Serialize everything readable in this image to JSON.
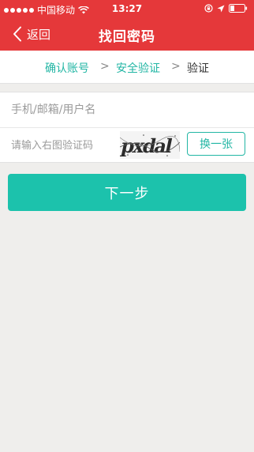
{
  "status_bar": {
    "carrier": "中国移动",
    "time": "13:27"
  },
  "nav": {
    "back_label": "返回",
    "title": "找回密码"
  },
  "steps": {
    "items": [
      "确认账号",
      "安全验证",
      "验证"
    ],
    "separator": ">",
    "active_color": "#22b6a4",
    "current_color": "#333333"
  },
  "form": {
    "account_placeholder": "手机/邮箱/用户名",
    "account_value": "",
    "captcha_placeholder": "请输入右图验证码",
    "captcha_value": "",
    "captcha_image_text": "pxdal",
    "refresh_label": "换一张"
  },
  "actions": {
    "next_label": "下一步"
  },
  "colors": {
    "header": "#e5383a",
    "accent": "#1cc2ac",
    "background": "#efeeec"
  }
}
